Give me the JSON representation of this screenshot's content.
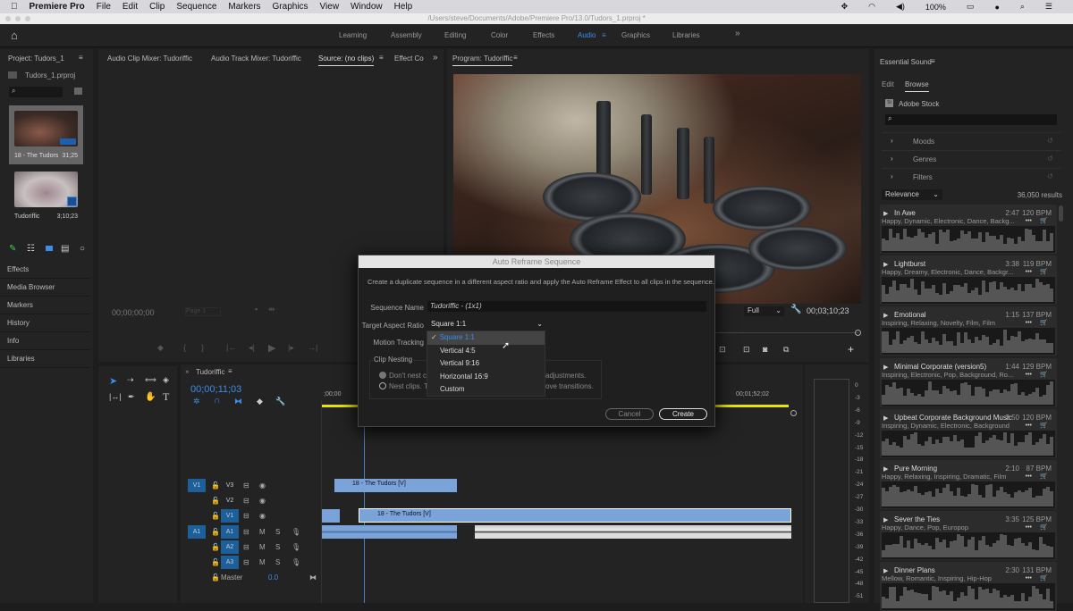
{
  "menubar": {
    "apple": "",
    "app": "Premiere Pro",
    "items": [
      "File",
      "Edit",
      "Clip",
      "Sequence",
      "Markers",
      "Graphics",
      "View",
      "Window",
      "Help"
    ],
    "battery": "100%"
  },
  "titlebar": {
    "path": "/Users/steve/Documents/Adobe/Premiere Pro/13.0/Tudors_1.prproj *"
  },
  "workspaces": {
    "items": [
      "Learning",
      "Assembly",
      "Editing",
      "Color",
      "Effects",
      "Audio",
      "Graphics",
      "Libraries"
    ],
    "active": "Audio",
    "more": "»"
  },
  "project": {
    "title": "Project: Tudors_1",
    "file": "Tudors_1.prproj",
    "items": [
      {
        "name": "18 - The Tudors",
        "duration": "31;25"
      },
      {
        "name": "Tudoriffic",
        "duration": "3;10;23"
      }
    ],
    "links": [
      "Effects",
      "Media Browser",
      "Markers",
      "History",
      "Info",
      "Libraries"
    ]
  },
  "source": {
    "tabs": [
      "Audio Clip Mixer: Tudoriffic",
      "Audio Track Mixer: Tudoriffic",
      "Source: (no clips)",
      "Effect Co"
    ],
    "more": "»",
    "timecode": "00;00;00;00",
    "page": "Page 1"
  },
  "program": {
    "title": "Program: Tudoriffic",
    "zoom": "Full",
    "timecode": "00;03;10;23"
  },
  "timeline": {
    "title": "Tudoriffic",
    "timecode": "00;00;11;03",
    "ruler": [
      ";00;00",
      "00;01;52;02"
    ],
    "video_tracks": [
      "V3",
      "V2",
      "V1"
    ],
    "audio_tracks": [
      "A1",
      "A2",
      "A3"
    ],
    "source_v": "V1",
    "source_a": "A1",
    "master": "Master",
    "master_value": "0.0",
    "mute": "M",
    "solo": "S",
    "clips": [
      "18 - The Tudors [V]",
      "18 - The Tudors [V]"
    ]
  },
  "meter": {
    "scale": [
      "0",
      "-3",
      "-6",
      "-9",
      "-12",
      "-15",
      "-18",
      "-21",
      "-24",
      "-27",
      "-30",
      "-33",
      "-36",
      "-39",
      "-42",
      "-45",
      "-48",
      "-51"
    ]
  },
  "dialog": {
    "title": "Auto Reframe Sequence",
    "description": "Create a duplicate sequence in a different aspect ratio and apply the Auto Reframe Effect to all clips in the sequence.",
    "sequence_name_label": "Sequence Name",
    "sequence_name": "Tudoriffic - (1x1)",
    "aspect_label": "Target Aspect Ratio",
    "aspect_value": "Square 1:1",
    "motion_label": "Motion Tracking",
    "nesting_label": "Clip Nesting",
    "nest_option_1": "Don't nest cli",
    "nest_option_1_tail": "adjustments.",
    "nest_option_2": "Nest clips. Th",
    "nest_option_2_tail": "ove transitions.",
    "options": [
      "Square 1:1",
      "Vertical 4:5",
      "Vertical 9:16",
      "Horizontal 16:9",
      "Custom"
    ],
    "selected": "Square 1:1",
    "cancel": "Cancel",
    "create": "Create"
  },
  "essential_sound": {
    "title": "Essential Sound",
    "tabs": [
      "Edit",
      "Browse"
    ],
    "active_tab": "Browse",
    "stock": "Adobe Stock",
    "stock_badge": "St",
    "filters": [
      "Moods",
      "Genres",
      "Filters"
    ],
    "sort": "Relevance",
    "results": "36,050 results",
    "tracks": [
      {
        "title": "In Awe",
        "duration": "2:47",
        "bpm": "120 BPM",
        "tags": "Happy, Dynamic, Electronic, Dance, Backg..."
      },
      {
        "title": "Lightburst",
        "duration": "3:38",
        "bpm": "119 BPM",
        "tags": "Happy, Dreamy, Electronic, Dance, Backgr..."
      },
      {
        "title": "Emotional",
        "duration": "1:15",
        "bpm": "137 BPM",
        "tags": "Inspiring, Relaxing, Novelty, Film, Film"
      },
      {
        "title": "Minimal Corporate (version5)",
        "duration": "1:44",
        "bpm": "129 BPM",
        "tags": "Inspiring, Electronic, Pop, Background, Ro..."
      },
      {
        "title": "Upbeat Corporate Background Music",
        "duration": "2:50",
        "bpm": "120 BPM",
        "tags": "Inspiring, Dynamic, Electronic, Background"
      },
      {
        "title": "Pure Morning",
        "duration": "2:10",
        "bpm": "87 BPM",
        "tags": "Happy, Relaxing, Inspiring, Dramatic, Film"
      },
      {
        "title": "Sever the Ties",
        "duration": "3:35",
        "bpm": "125 BPM",
        "tags": "Happy, Dance, Pop, Europop"
      },
      {
        "title": "Dinner Plans",
        "duration": "2:30",
        "bpm": "131 BPM",
        "tags": "Mellow, Romantic, Inspiring, Hip-Hop"
      }
    ]
  },
  "colors": {
    "accent": "#3c8ce8",
    "clip": "#7aa3d9",
    "track_badge": "#1c5f99",
    "playhead_bar": "#e6e600"
  }
}
